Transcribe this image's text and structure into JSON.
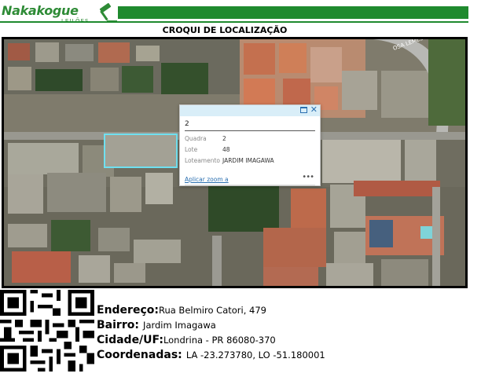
{
  "header": {
    "brand_name": "Nakakogue",
    "brand_sub": "LEILÕES",
    "brand_color": "#2e8b36",
    "bar_color": "#1f8a2e",
    "logo_icon": "gavel-icon",
    "title": "CROQUI DE LOCALIZAÇÃO"
  },
  "map": {
    "street_label": "OSA LEMES",
    "highlight_color": "#6fe0f0"
  },
  "popup": {
    "title": "2",
    "attributes": [
      {
        "key": "Quadra",
        "value": "2"
      },
      {
        "key": "Lote",
        "value": "48"
      },
      {
        "key": "Loteamento",
        "value": "JARDIM IMAGAWA"
      }
    ],
    "zoom_link": "Aplicar zoom a",
    "more_glyph": "•••",
    "close_glyph": "✕",
    "maximize_icon": "maximize-icon",
    "close_icon": "close-icon",
    "bar_color": "#d9eef8",
    "link_color": "#2a6fb0"
  },
  "qr": {
    "icon": "qr-code-icon"
  },
  "address": {
    "endereco_label": "Endereço:",
    "endereco_value": "Rua Belmiro Catori, 479",
    "bairro_label": "Bairro:",
    "bairro_value": "Jardim Imagawa",
    "cidade_label": "Cidade/UF:",
    "cidade_value": "Londrina - PR 86080-370",
    "coord_label": "Coordenadas:",
    "coord_value": "LA -23.273780, LO -51.180001"
  }
}
